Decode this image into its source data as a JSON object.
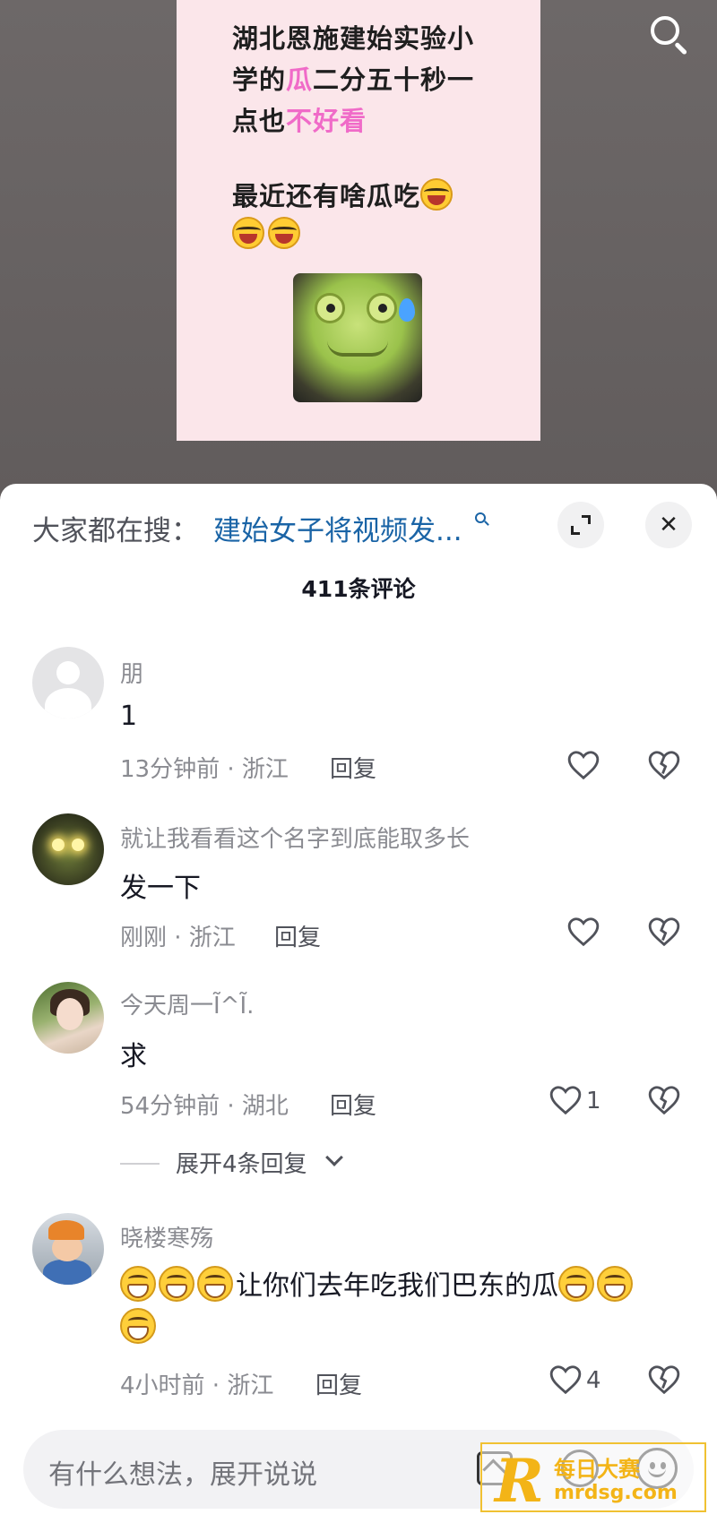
{
  "video": {
    "post_lines": [
      {
        "parts": [
          "湖北恩施建始实验小"
        ]
      },
      {
        "parts": [
          "学的",
          "瓜",
          "二分五十秒一"
        ]
      },
      {
        "parts": [
          "点也",
          "不好看"
        ]
      },
      {
        "parts": [
          "最近还有啥瓜吃"
        ]
      }
    ]
  },
  "sheet": {
    "search_prefix": "大家都在搜：",
    "search_query": "建始女子将视频发...",
    "comment_count": "411条评论"
  },
  "comments": [
    {
      "name": "朋",
      "text": "1",
      "time_location": "13分钟前 · 浙江",
      "reply": "回复",
      "likes": ""
    },
    {
      "name": "就让我看看这个名字到底能取多长",
      "text": "发一下",
      "time_location": "刚刚 · 浙江",
      "reply": "回复",
      "likes": ""
    },
    {
      "name": "今天周一Ĩ^Ĩ.",
      "text": "求",
      "time_location": "54分钟前 · 湖北",
      "reply": "回复",
      "likes": "1"
    },
    {
      "name": "晓楼寒殇",
      "text": "让你们去年吃我们巴东的瓜",
      "time_location": "4小时前 · 浙江",
      "reply": "回复",
      "likes": "4"
    }
  ],
  "expand_replies": "展开4条回复",
  "input": {
    "placeholder": "有什么想法，展开说说"
  },
  "watermark": {
    "brand": "每日大赛",
    "url": "mrdsg.com"
  },
  "colors": {
    "accent_pink": "#f06bc8",
    "search_link": "#1a64a6"
  },
  "icons": [
    "search-icon",
    "expand-icon",
    "close-icon",
    "heart-icon",
    "dislike-icon",
    "image-icon",
    "at-icon",
    "emoji-icon"
  ]
}
